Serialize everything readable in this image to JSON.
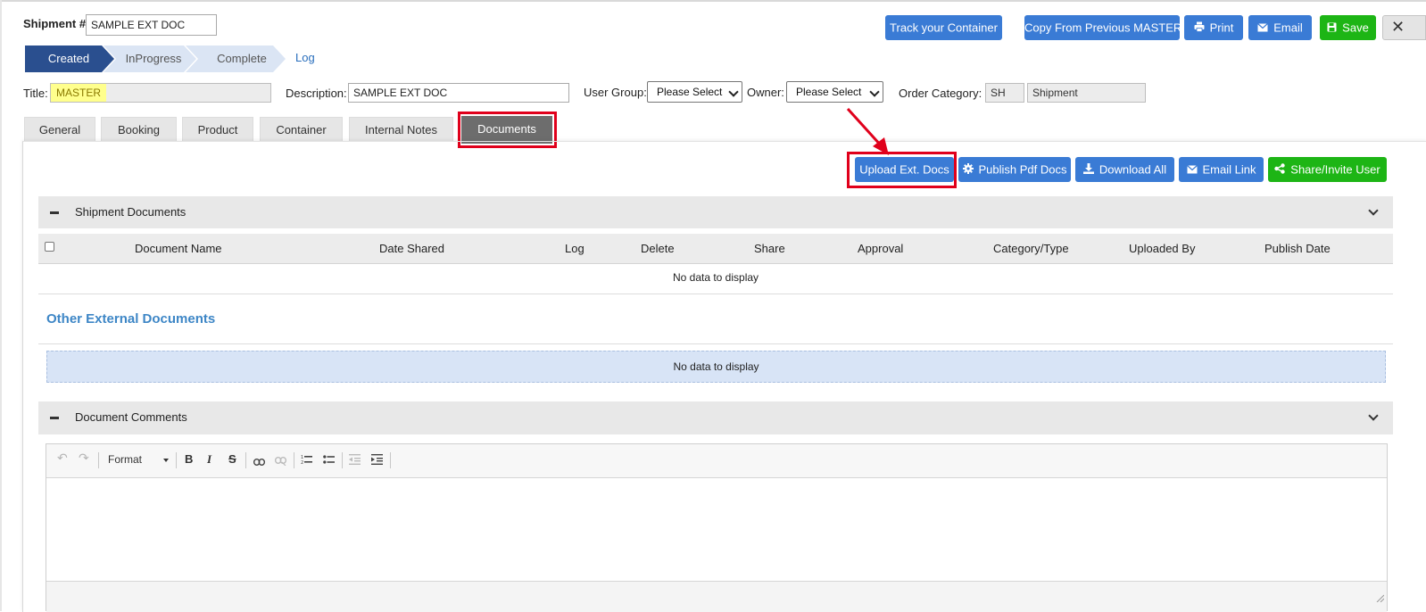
{
  "header": {
    "shipment_label": "Shipment #:",
    "shipment_value": "SAMPLE EXT DOC",
    "buttons": {
      "track": "Track your Container",
      "copy": "Copy From Previous MASTER",
      "print": "Print",
      "email": "Email",
      "save": "Save"
    }
  },
  "progress": {
    "steps": [
      "Created",
      "InProgress",
      "Complete"
    ],
    "log_link": "Log"
  },
  "form": {
    "title_label": "Title:",
    "title_value": "MASTER",
    "description_label": "Description:",
    "description_value": "SAMPLE EXT DOC",
    "user_group_label": "User Group:",
    "user_group_value": "Please Select",
    "owner_label": "Owner:",
    "owner_value": "Please Select",
    "order_category_label": "Order Category:",
    "order_category_code": "SH",
    "order_category_name": "Shipment"
  },
  "tabs": [
    "General",
    "Booking",
    "Product",
    "Container",
    "Internal Notes",
    "Documents"
  ],
  "doc_toolbar": {
    "upload": "Upload Ext. Docs",
    "publish": "Publish Pdf Docs",
    "download": "Download All",
    "email_link": "Email Link",
    "share": "Share/Invite User"
  },
  "shipment_documents": {
    "title": "Shipment Documents",
    "columns": [
      "Document Name",
      "Date Shared",
      "Log",
      "Delete",
      "Share",
      "Approval",
      "Category/Type",
      "Uploaded By",
      "Publish Date"
    ],
    "empty": "No data to display"
  },
  "other_external": {
    "title": "Other External Documents",
    "empty": "No data to display"
  },
  "comments": {
    "title": "Document Comments",
    "format_label": "Format"
  },
  "colors": {
    "accent": "#3a7bd5",
    "success": "#1db515",
    "step_active": "#2a4f8f",
    "highlight": "#e0001b"
  }
}
